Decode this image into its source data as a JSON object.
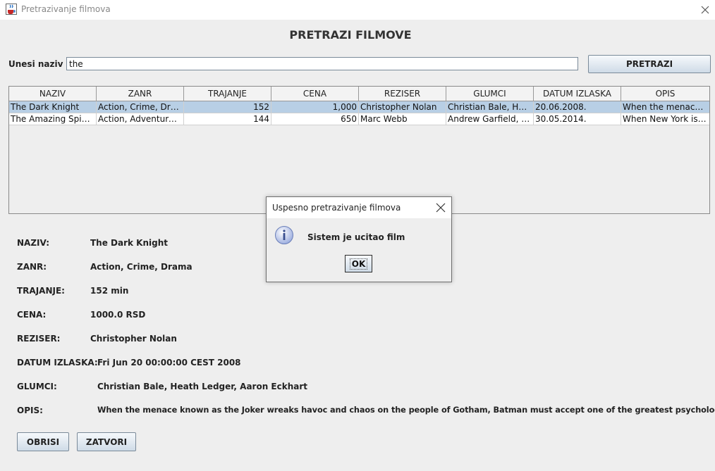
{
  "window": {
    "title": "Pretrazivanje filmova"
  },
  "heading": "PRETRAZI FILMOVE",
  "search": {
    "label": "Unesi naziv",
    "value": "the",
    "button": "PRETRAZI"
  },
  "table": {
    "columns": [
      "NAZIV",
      "ZANR",
      "TRAJANJE",
      "CENA",
      "REZISER",
      "GLUMCI",
      "DATUM IZLASKA",
      "OPIS"
    ],
    "rows": [
      {
        "selected": true,
        "cells": [
          "The Dark Knight",
          "Action, Crime, Drama",
          "152",
          "1,000",
          "Christopher Nolan",
          "Christian Bale, Heat...",
          "20.06.2008.",
          "When the menace k..."
        ]
      },
      {
        "selected": false,
        "cells": [
          "The Amazing Spider...",
          "Action, Adventure, S...",
          "144",
          "650",
          "Marc Webb",
          "Andrew Garfield, Em...",
          "30.05.2014.",
          "When New York is p..."
        ]
      }
    ]
  },
  "details": {
    "naziv": {
      "label": "NAZIV:",
      "value": "The Dark Knight"
    },
    "zanr": {
      "label": "ZANR:",
      "value": "Action, Crime, Drama"
    },
    "trajanje": {
      "label": "TRAJANJE:",
      "value": "152 min"
    },
    "cena": {
      "label": "CENA:",
      "value": "1000.0 RSD"
    },
    "reziser": {
      "label": "REZISER:",
      "value": "Christopher Nolan"
    },
    "datum": {
      "label": "DATUM IZLASKA:",
      "value": "Fri Jun 20 00:00:00 CEST 2008"
    },
    "glumci": {
      "label": "GLUMCI:",
      "value": "Christian Bale, Heath Ledger, Aaron Eckhart"
    },
    "opis": {
      "label": "OPIS:",
      "value": "When the menace known as the Joker wreaks havoc and chaos on the people of Gotham, Batman must accept one of the greatest psychological..."
    }
  },
  "buttons": {
    "delete": "OBRISI",
    "close": "ZATVORI"
  },
  "dialog": {
    "title": "Uspesno pretrazivanje filmova",
    "message": "Sistem je ucitao film",
    "ok": "OK"
  },
  "colors": {
    "background": "#eeeeee",
    "selected_row": "#b8cfe5",
    "button_top": "#f6f9fc",
    "button_bottom": "#cfdbe7"
  },
  "icons": {
    "app": "java-cup-icon",
    "close": "close-icon",
    "info": "info-icon"
  }
}
